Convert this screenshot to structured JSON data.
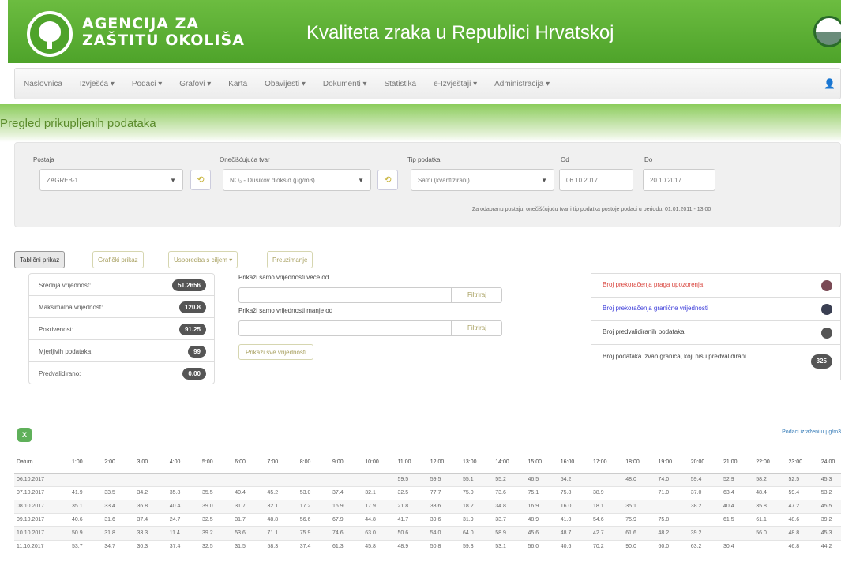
{
  "header": {
    "agency_line1": "AGENCIJA ZA",
    "agency_line2": "ZAŠTITU OKOLIŠA",
    "title": "Kvaliteta zraka u Republici Hrvatskoj"
  },
  "nav": {
    "items": [
      "Naslovnica",
      "Izvješća ▾",
      "Podaci ▾",
      "Grafovi ▾",
      "Karta",
      "Obavijesti ▾",
      "Dokumenti ▾",
      "Statistika",
      "e-Izvještaji ▾",
      "Administracija ▾"
    ],
    "user_icon": "user-icon"
  },
  "page_title": "Pregled prikupljenih podataka",
  "filters": {
    "station_label": "Postaja",
    "station_value": "ZAGREB-1",
    "pollutant_label": "Onečišćujuća tvar",
    "pollutant_value": "NO₂ - Dušikov dioksid (µg/m3)",
    "data_type_label": "Tip podatka",
    "data_type_value": "Satni (kvantizirani)",
    "from_label": "Od",
    "from_value": "06.10.2017",
    "to_label": "Do",
    "to_value": "20.10.2017",
    "reset_glyph": "⟲",
    "note": "Za odabranu postaju, onečišćujuću tvar i tip podatka postoje podaci u periodu: 01.01.2011 - 13:00"
  },
  "tabs": [
    "Tablični prikaz",
    "Grafički prikaz",
    "Usporedba s ciljem ▾",
    "Preuzimanje"
  ],
  "stats": [
    {
      "label": "Srednja vrijednost:",
      "value": "51.2656"
    },
    {
      "label": "Maksimalna vrijednost:",
      "value": "120.8"
    },
    {
      "label": "Pokrivenost:",
      "value": "91.25"
    },
    {
      "label": "Mjerljivih podataka:",
      "value": "99"
    },
    {
      "label": "Predvalidirano:",
      "value": "0.00"
    }
  ],
  "value_filter": {
    "greater_label": "Prikaži samo vrijednosti veće od",
    "less_label": "Prikaži samo vrijednosti manje od",
    "filter_button": "Filtriraj",
    "all_button": "Prikaži sve vrijednosti"
  },
  "counters": [
    {
      "label": "Broj prekoračenja praga upozorenja",
      "color": "#d9463f",
      "dot": "#7a4a55"
    },
    {
      "label": "Broj prekoračenja granične vrijednosti",
      "color": "#3b3bd9",
      "dot": "#3a3f52"
    },
    {
      "label": "Broj predvalidiranih podataka",
      "color": "#444444",
      "dot": "#555555"
    },
    {
      "label": "Broj podataka izvan granica, koji nisu predvalidirani",
      "color": "#444444",
      "badge": "325"
    }
  ],
  "table": {
    "export_glyph": "X",
    "link": "Podaci izraženi u µg/m3",
    "headers": [
      "Datum",
      "1:00",
      "2:00",
      "3:00",
      "4:00",
      "5:00",
      "6:00",
      "7:00",
      "8:00",
      "9:00",
      "10:00",
      "11:00",
      "12:00",
      "13:00",
      "14:00",
      "15:00",
      "16:00",
      "17:00",
      "18:00",
      "19:00",
      "20:00",
      "21:00",
      "22:00",
      "23:00",
      "24:00"
    ],
    "rows": [
      [
        "06.10.2017",
        "",
        "",
        "",
        "",
        "",
        "",
        "",
        "",
        "",
        "",
        "59.5",
        "59.5",
        "55.1",
        "55.2",
        "46.5",
        "54.2",
        "",
        "48.0",
        "74.0",
        "59.4",
        "52.9",
        "58.2",
        "52.5",
        "45.3"
      ],
      [
        "07.10.2017",
        "41.9",
        "33.5",
        "34.2",
        "35.8",
        "35.5",
        "40.4",
        "45.2",
        "53.0",
        "37.4",
        "32.1",
        "32.5",
        "77.7",
        "75.0",
        "73.6",
        "75.1",
        "75.8",
        "38.9",
        "",
        "71.0",
        "37.0",
        "63.4",
        "48.4",
        "59.4",
        "53.2"
      ],
      [
        "08.10.2017",
        "35.1",
        "33.4",
        "36.8",
        "40.4",
        "39.0",
        "31.7",
        "32.1",
        "17.2",
        "16.9",
        "17.9",
        "21.8",
        "33.6",
        "18.2",
        "34.8",
        "16.9",
        "16.0",
        "18.1",
        "35.1",
        "",
        "38.2",
        "40.4",
        "35.8",
        "47.2",
        "45.5"
      ],
      [
        "09.10.2017",
        "40.6",
        "31.6",
        "37.4",
        "24.7",
        "32.5",
        "31.7",
        "48.8",
        "56.6",
        "67.9",
        "44.8",
        "41.7",
        "39.6",
        "31.9",
        "33.7",
        "48.9",
        "41.0",
        "54.6",
        "75.9",
        "75.8",
        "",
        "61.5",
        "61.1",
        "48.6",
        "39.2"
      ],
      [
        "10.10.2017",
        "50.9",
        "31.8",
        "33.3",
        "11.4",
        "39.2",
        "53.6",
        "71.1",
        "75.9",
        "74.6",
        "63.0",
        "50.6",
        "54.0",
        "64.0",
        "58.9",
        "45.6",
        "48.7",
        "42.7",
        "61.6",
        "48.2",
        "39.2",
        "",
        "56.0",
        "48.8",
        "45.3"
      ],
      [
        "11.10.2017",
        "53.7",
        "34.7",
        "30.3",
        "37.4",
        "32.5",
        "31.5",
        "58.3",
        "37.4",
        "61.3",
        "45.8",
        "48.9",
        "50.8",
        "59.3",
        "53.1",
        "56.0",
        "40.6",
        "70.2",
        "90.0",
        "60.0",
        "63.2",
        "30.4",
        "",
        "46.8",
        "44.2"
      ]
    ]
  }
}
